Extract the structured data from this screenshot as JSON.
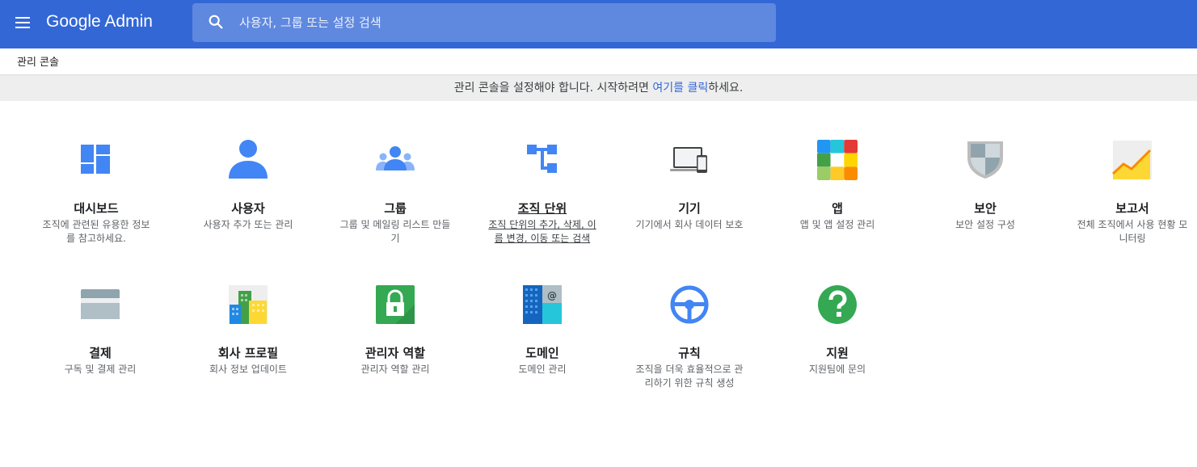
{
  "header": {
    "app_name": "Google Admin",
    "search_placeholder": "사용자, 그룹 또는 설정 검색",
    "brand_color": "#3367d6"
  },
  "breadcrumb": "관리 콘솔",
  "banner": {
    "text_before": "관리 콘솔을 설정해야 합니다. 시작하려면 ",
    "link_text": "여기를 클릭",
    "text_after": "하세요."
  },
  "tiles": [
    {
      "icon": "dashboard-icon",
      "title": "대시보드",
      "desc": "조직에 관련된 유용한 정보를 참고하세요."
    },
    {
      "icon": "user-icon",
      "title": "사용자",
      "desc": "사용자 추가 또는 관리"
    },
    {
      "icon": "group-icon",
      "title": "그룹",
      "desc": "그룹 및 메일링 리스트 만들기"
    },
    {
      "icon": "org-unit-icon",
      "title": "조직 단위",
      "desc": "조직 단위의 추가, 삭제, 이름 변경, 이동 또는 검색"
    },
    {
      "icon": "devices-icon",
      "title": "기기",
      "desc": "기기에서 회사 데이터 보호"
    },
    {
      "icon": "apps-icon",
      "title": "앱",
      "desc": "앱 및 앱 설정 관리"
    },
    {
      "icon": "security-shield-icon",
      "title": "보안",
      "desc": "보안 설정 구성"
    },
    {
      "icon": "reports-chart-icon",
      "title": "보고서",
      "desc": "전체 조직에서 사용 현황 모니터링"
    },
    {
      "icon": "billing-card-icon",
      "title": "결제",
      "desc": "구독 및 결제 관리"
    },
    {
      "icon": "company-building-icon",
      "title": "회사 프로필",
      "desc": "회사 정보 업데이트"
    },
    {
      "icon": "admin-lock-icon",
      "title": "관리자 역할",
      "desc": "관리자 역할 관리"
    },
    {
      "icon": "domain-building-icon",
      "title": "도메인",
      "desc": "도메인 관리"
    },
    {
      "icon": "rules-steering-icon",
      "title": "규칙",
      "desc": "조직을 더욱 효율적으로 관리하기 위한 규칙 생성"
    },
    {
      "icon": "support-question-icon",
      "title": "지원",
      "desc": "지원팀에 문의"
    }
  ]
}
